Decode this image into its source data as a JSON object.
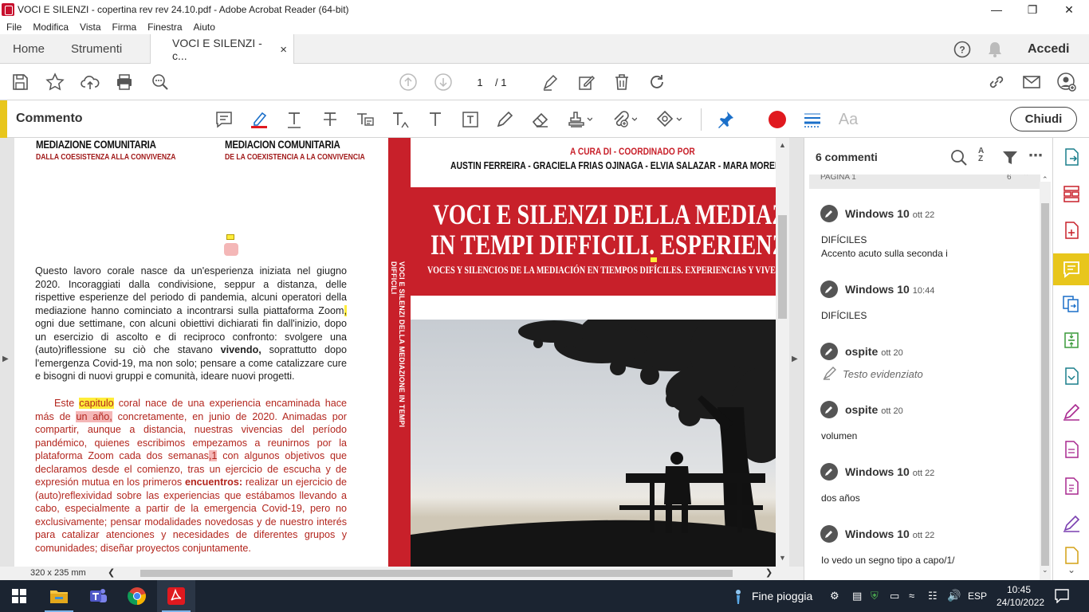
{
  "window": {
    "title": "VOCI E SILENZI - copertina rev rev 24.10.pdf - Adobe Acrobat Reader (64-bit)"
  },
  "menu": [
    "File",
    "Modifica",
    "Vista",
    "Firma",
    "Finestra",
    "Aiuto"
  ],
  "tabs": {
    "home": "Home",
    "tools": "Strumenti",
    "document": "VOCI E SILENZI - c...",
    "close": "×",
    "signin": "Accedi"
  },
  "toolbar": {
    "page_current": "1",
    "page_total": "/ 1"
  },
  "comment_bar": {
    "title": "Commento",
    "close_label": "Chiudi",
    "font_label": "Aa"
  },
  "document": {
    "left_header_it": "MEDIAZIONE COMUNITARIA",
    "left_sub_it": "DALLA COESISTENZA ALLA CONVIVENZA",
    "left_header_es": "MEDIACION COMUNITARIA",
    "left_sub_es": "DE LA COEXISTENCIA A LA CONVIVENCIA",
    "para_it": {
      "a": "Questo lavoro corale nasce da un'esperienza iniziata nel giugno 2020. Incoraggiati dalla condivisione, seppur a distanza, delle rispettive esperienze del periodo di pandemia, alcuni operatori della mediazione hanno cominciato a incontrarsi sulla piattaforma Zoom",
      "hl": ",",
      "b": " ogni due settimane, con alcuni obiettivi dichiarati fin dall'inizio, dopo un esercizio di ascolto e di reciproco confronto: svolgere una (auto)riflessione su ciò che stavano ",
      "bold": "vivendo,",
      "c": " soprattutto dopo l'emergenza Covid-19, ma non solo; pensare a come catalizzare cure e bisogni di nuovi gruppi e comunità, ideare nuovi progetti."
    },
    "para_es": {
      "a": "Este ",
      "hl1": "capitulo",
      "b": " coral nace de una experiencia encaminada hace más de ",
      "hl2": "un año,",
      "c": " concretamente, en junio de 2020. Animadas por compartir, aunque a distancia, nuestras vivencias del período pandémico, quienes escribimos empezamos a reunirnos por la plataforma Zoom cada dos semanas",
      "hl3": ",1",
      "d": " con algunos objetivos que declaramos desde el comienzo, tras un ejercicio de escucha y de expresión mutua en los primeros ",
      "bold": "encuentros:",
      "e": " realizar un ejercicio de (auto)reflexividad sobre las experiencias que estábamos llevando a cabo, especialmente a partir de la emergencia Covid-19, pero no exclusivamente; pensar modalidades novedosas y de nuestro interés para catalizar atenciones y necesidades de diferentes grupos y comunidades; diseñar proyectos conjuntamente."
    },
    "cover": {
      "curated": "A CURA DI - COORDINADO POR",
      "authors": "AUSTIN FERREIRA - GRACIELA FRIAS OJINAGA - ELVIA SALAZAR - MARA MORELLI - SILVIA VEC",
      "title_line1": "VOCI E SILENZI DELLA MEDIAZIONE",
      "title_line2": "IN TEMPI DIFFICILI. ESPERIENZE E VISSUT",
      "subtitle": "VOCES Y SILENCIOS DE LA MEDIACIÓN EN TIEMPOS DIFÍCILES. EXPERIENCIAS Y VIVENC",
      "spine": "VOCI E SILENZI DELLA MEDIAZIONE IN TEMPI DIFFICILI"
    },
    "page_size": "320 x 235 mm"
  },
  "comments_panel": {
    "count_label": "6 commenti",
    "page_label": "PAGINA 1",
    "page_count": "6",
    "comments": [
      {
        "author": "Windows 10",
        "date": "ott 22",
        "line1": "DIFÍCILES",
        "line2": "Accento acuto sulla seconda i"
      },
      {
        "author": "Windows 10",
        "date": "10:44",
        "line1": "DIFÍCILES",
        "line2": ""
      },
      {
        "author": "ospite",
        "date": "ott 20",
        "line1": "Testo evidenziato",
        "line2": ""
      },
      {
        "author": "ospite",
        "date": "ott 20",
        "line1": "volumen",
        "line2": ""
      },
      {
        "author": "Windows 10",
        "date": "ott 22",
        "line1": "dos años",
        "line2": ""
      },
      {
        "author": "Windows 10",
        "date": "ott 22",
        "line1": "Io vedo un segno tipo a capo/1/",
        "line2": ""
      }
    ]
  },
  "taskbar": {
    "weather": "Fine pioggia",
    "lang": "ESP",
    "time": "10:45",
    "date": "24/10/2022"
  },
  "colors": {
    "accent_yellow": "#e8c61c",
    "highlight_yellow": "#ffed3a",
    "highlight_pink": "#f4b7b7",
    "cover_red": "#c8202a",
    "record_red": "#e0191f",
    "pin_blue": "#1a6fc9",
    "taskbar": "#1b2431"
  }
}
